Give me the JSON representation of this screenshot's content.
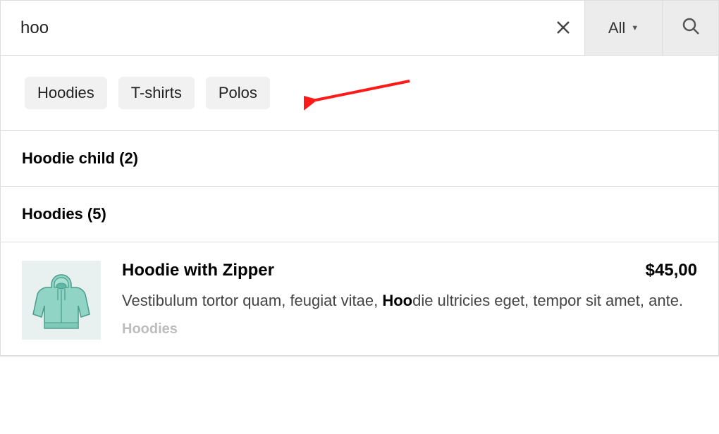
{
  "search": {
    "query": "hoo",
    "placeholder": "",
    "filter_label": "All"
  },
  "chips": [
    {
      "label": "Hoodies"
    },
    {
      "label": "T-shirts"
    },
    {
      "label": "Polos"
    }
  ],
  "categories": [
    {
      "name": "Hoodie child",
      "count": 2,
      "display": "Hoodie child (2)"
    },
    {
      "name": "Hoodies",
      "count": 5,
      "display": "Hoodies (5)"
    }
  ],
  "product": {
    "title_hl": "Hoo",
    "title_rest": "die with Zipper",
    "price": "$45,00",
    "desc_before": "Vestibulum tortor quam, feugiat vitae, ",
    "desc_hl": "Hoo",
    "desc_after": "die ultricies eget, tempor sit amet, ante.",
    "cat_hl": "Hoo",
    "cat_rest": "dies"
  }
}
